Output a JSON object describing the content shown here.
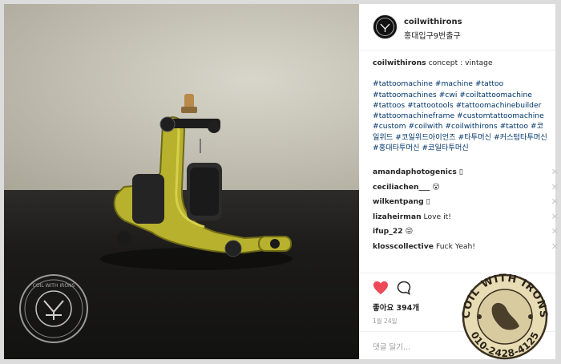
{
  "post": {
    "username": "coilwithirons",
    "location": "홍대입구9번출구",
    "caption_user": "coilwithirons",
    "caption_text": "concept : vintage",
    "hashtags": "#tattoomachine #machine #tattoo #tattoomachines #cwi #coiltattoomachine #tattoos #tattootools #tattoomachinebuilder #tattoomachineframe #customtattoomachine #custom #coilwith #coilwithirons #tattoo #코일위드 #코일위드아이언즈 #타투머신 #커스텀타투머신 #홍대타투머신 #코일타투머신",
    "likes": "좋아요 394개",
    "date": "1월 24일",
    "add_comment_placeholder": "댓글 달기..."
  },
  "comments": [
    {
      "user": "amandaphotogenics",
      "text": "▯"
    },
    {
      "user": "ceciliachen___",
      "text": "😮"
    },
    {
      "user": "wilkentpang",
      "text": "▯"
    },
    {
      "user": "lizaheirman",
      "text": "Love it!"
    },
    {
      "user": "ifup_22",
      "text": "😜"
    },
    {
      "user": "klosscollective",
      "text": "Fuck Yeah!"
    }
  ],
  "icons": {
    "heart": "heart-icon",
    "comment": "comment-icon",
    "remove": "close-icon"
  },
  "watermark": {
    "seal_text": "COIL WITH IRONS",
    "stamp_top": "COIL WITH IRONS",
    "stamp_bottom": "010-2428-4125"
  },
  "colors": {
    "like_red": "#ed4956",
    "hashtag_blue": "#003569",
    "stamp_tan": "#e8dcb5"
  }
}
